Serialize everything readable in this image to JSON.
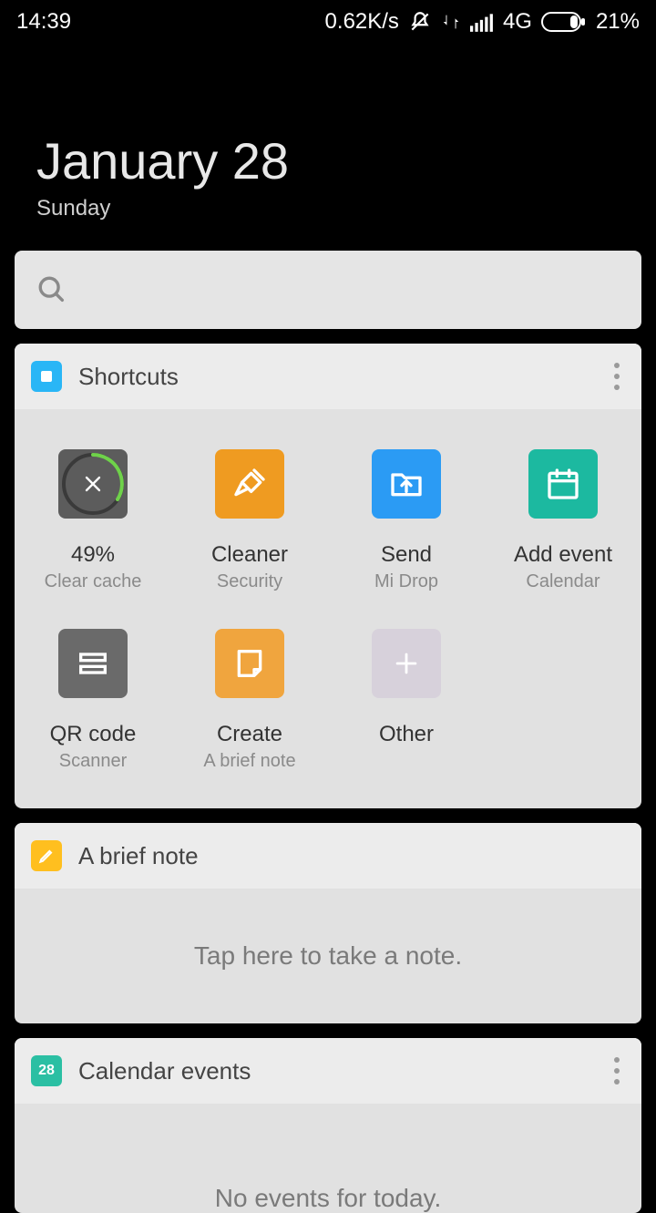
{
  "status": {
    "time": "14:39",
    "net_speed": "0.62K/s",
    "network_label": "4G",
    "battery": "21%"
  },
  "date": {
    "long": "January 28",
    "weekday": "Sunday"
  },
  "shortcuts_card": {
    "title": "Shortcuts",
    "items": [
      {
        "label": "49%",
        "sub": "Clear cache"
      },
      {
        "label": "Cleaner",
        "sub": "Security"
      },
      {
        "label": "Send",
        "sub": "Mi Drop"
      },
      {
        "label": "Add event",
        "sub": "Calendar"
      },
      {
        "label": "QR code",
        "sub": "Scanner"
      },
      {
        "label": "Create",
        "sub": "A brief note"
      },
      {
        "label": "Other",
        "sub": ""
      }
    ]
  },
  "note_card": {
    "title": "A brief note",
    "placeholder": "Tap here to take a note."
  },
  "calendar_card": {
    "title": "Calendar events",
    "badge": "28",
    "empty_text": "No events for today."
  }
}
